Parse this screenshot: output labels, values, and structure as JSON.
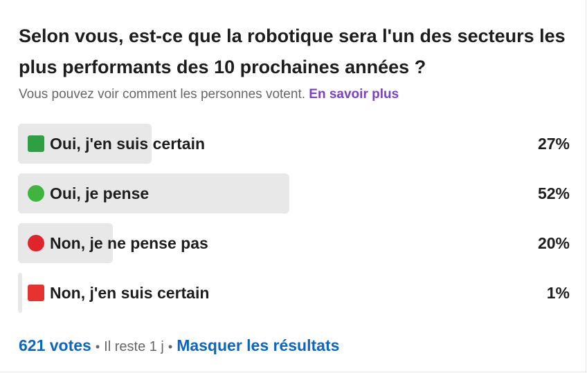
{
  "poll": {
    "question": "Selon vous, est-ce que la robotique sera l'un des secteurs les plus performants des 10 prochaines années ?",
    "visibility_note": "Vous pouvez voir comment les personnes votent.",
    "learn_more": "En savoir plus",
    "options": [
      {
        "label": "Oui, j'en suis certain",
        "percent_label": "27%",
        "percent": 27,
        "icon": "green-square-icon",
        "icon_color": "#2ea043"
      },
      {
        "label": "Oui, je pense",
        "percent_label": "52%",
        "percent": 52,
        "icon": "green-circle-icon",
        "icon_color": "#3fb53f"
      },
      {
        "label": "Non, je ne pense pas",
        "percent_label": "20%",
        "percent": 20,
        "icon": "red-circle-icon",
        "icon_color": "#e0242b"
      },
      {
        "label": "Non, j'en suis certain",
        "percent_label": "1%",
        "percent": 1,
        "icon": "red-square-icon",
        "icon_color": "#e63230"
      }
    ],
    "footer": {
      "votes": "621 votes",
      "separator": "•",
      "remaining": "Il reste 1 j",
      "hide_results": "Masquer les résultats"
    }
  },
  "colors": {
    "link_blue": "#0a66c2",
    "learn_more_purple": "#7c3fc7",
    "bar_gray": "#e8e8e8",
    "text_dark": "#1d1d1d",
    "text_muted": "#666666"
  }
}
